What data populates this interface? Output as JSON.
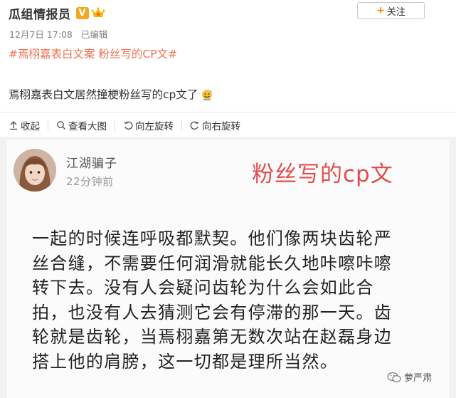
{
  "post": {
    "author": "瓜组情报员",
    "verified_badge": "V",
    "follow_label": "关注",
    "follow_plus": "+",
    "date": "12月7日 17:08",
    "edited": "已编辑",
    "topics": [
      "#焉栩嘉表白文案 粉丝写的CP文#"
    ],
    "text": "焉栩嘉表白文居然撞梗粉丝写的cp文了",
    "emoji": "sweat-smile-emoji"
  },
  "toolbar": {
    "collapse": "收起",
    "view_large": "查看大图",
    "rotate_left": "向左旋转",
    "rotate_right": "向右旋转"
  },
  "image": {
    "inner_author": "江湖骗子",
    "inner_time": "22分钟前",
    "title": "粉丝写的cp文",
    "lines": [
      "一起的时候连呼吸都默契。他们像两块齿轮严",
      "丝合缝，不需要任何润滑就能长久地咔嚓咔嚓",
      "转下去。没有人会疑问齿轮为什么会如此合",
      "拍，也没有人去猜测它会有停滞的那一天。齿",
      "轮就是齿轮，当焉栩嘉第无数次站在赵磊身边",
      "搭上他的肩膀，这一切都是理所当然。"
    ],
    "watermark": "萝严肃"
  },
  "colors": {
    "topic": "#eb7350",
    "accent": "#ff8200",
    "image_title": "#e04e4e"
  }
}
